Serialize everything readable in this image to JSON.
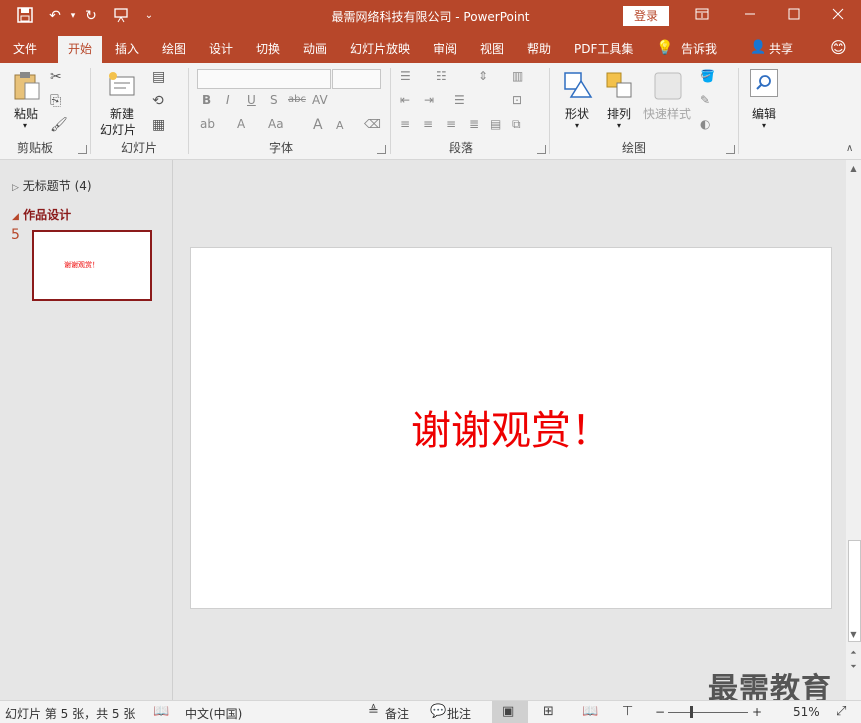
{
  "window": {
    "title": "最需网络科技有限公司  -  PowerPoint",
    "login_label": "登录",
    "controls": [
      "▢",
      "—",
      "☐",
      "✕"
    ]
  },
  "quick_access": {
    "save_icon": "save-icon",
    "undo_icon": "undo-icon",
    "redo_icon": "redo-icon",
    "present_icon": "start-from-beginning-icon",
    "more": "⌄"
  },
  "tabs": [
    {
      "label": "文件"
    },
    {
      "label": "开始",
      "active": true
    },
    {
      "label": "插入"
    },
    {
      "label": "绘图"
    },
    {
      "label": "设计"
    },
    {
      "label": "切换"
    },
    {
      "label": "动画"
    },
    {
      "label": "幻灯片放映"
    },
    {
      "label": "审阅"
    },
    {
      "label": "视图"
    },
    {
      "label": "帮助"
    },
    {
      "label": "PDF工具集"
    },
    {
      "label": "告诉我"
    },
    {
      "label": "共享"
    }
  ],
  "ribbon": {
    "clipboard": {
      "paste": "粘贴",
      "group": "剪贴板"
    },
    "slides": {
      "new_slide_line1": "新建",
      "new_slide_line2": "幻灯片",
      "group": "幻灯片"
    },
    "font": {
      "group": "字体",
      "bold": "B",
      "italic": "I",
      "underline": "U",
      "shadow": "S",
      "strike": "abc",
      "spacing": "AV",
      "font_color": "A",
      "size_up": "A",
      "size_down": "A",
      "case": "Aa"
    },
    "paragraph": {
      "group": "段落"
    },
    "drawing": {
      "shapes": "形状",
      "arrange": "排列",
      "quick_styles": "快速样式",
      "group": "绘图"
    },
    "editing": {
      "label": "编辑"
    }
  },
  "left_pane": {
    "section1": "无标题节 (4)",
    "section2": "作品设计",
    "slide_number": "5",
    "thumb_text": "谢谢观赏！"
  },
  "slide": {
    "text": "谢谢观赏！",
    "text_color": "#ee0000"
  },
  "status": {
    "slide_info": "幻灯片 第 5 张，共 5 张",
    "language": "中文(中国)",
    "notes": "备注",
    "comments": "批注",
    "zoom": "51%",
    "zoom_minus": "−",
    "zoom_plus": "+"
  },
  "watermark": "最需教育",
  "colors": {
    "accent": "#b7472a",
    "ribbon": "#f3f3f3"
  }
}
